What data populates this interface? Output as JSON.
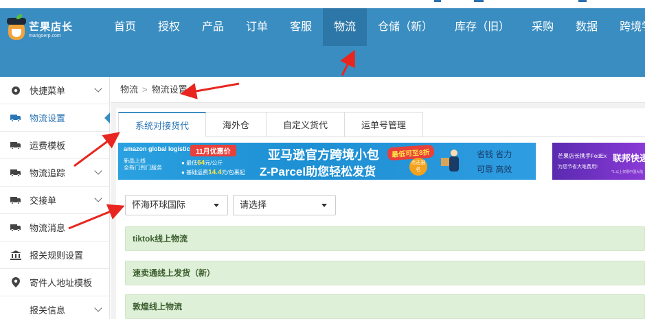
{
  "header": {
    "logo": {
      "name": "芒果店长",
      "domain": "mangoerp.com"
    },
    "nav": [
      {
        "label": "首页",
        "active": false
      },
      {
        "label": "授权",
        "active": false
      },
      {
        "label": "产品",
        "active": false
      },
      {
        "label": "订单",
        "active": false
      },
      {
        "label": "客服",
        "active": false
      },
      {
        "label": "物流",
        "active": true
      },
      {
        "label": "仓储（新）",
        "active": false
      },
      {
        "label": "库存（旧）",
        "active": false
      },
      {
        "label": "采购",
        "active": false
      },
      {
        "label": "数据",
        "active": false
      },
      {
        "label": "跨境学",
        "active": false
      }
    ]
  },
  "sidebar": {
    "items": [
      {
        "label": "快捷菜单",
        "icon": "dashboard-icon",
        "has_chevron": true,
        "active": false
      },
      {
        "label": "物流设置",
        "icon": "truck-icon",
        "has_chevron": false,
        "active": true
      },
      {
        "label": "运费模板",
        "icon": "truck-icon",
        "has_chevron": false,
        "active": false
      },
      {
        "label": "物流追踪",
        "icon": "truck-icon",
        "has_chevron": true,
        "active": false
      },
      {
        "label": "交接单",
        "icon": "truck-icon",
        "has_chevron": true,
        "active": false
      },
      {
        "label": "物流消息",
        "icon": "truck-icon",
        "has_chevron": false,
        "active": false
      },
      {
        "label": "报关规则设置",
        "icon": "bank-icon",
        "has_chevron": false,
        "active": false
      },
      {
        "label": "寄件人地址模板",
        "icon": "location-pin-icon",
        "has_chevron": false,
        "active": false
      },
      {
        "label": "报关信息",
        "icon": "",
        "has_chevron": true,
        "active": false
      }
    ]
  },
  "breadcrumb": {
    "root": "物流",
    "separator": ">",
    "current": "物流设置"
  },
  "tabs": [
    {
      "label": "系统对接货代",
      "active": true
    },
    {
      "label": "海外仓",
      "active": false
    },
    {
      "label": "自定义货代",
      "active": false
    },
    {
      "label": "运单号管理",
      "active": false
    }
  ],
  "banner": {
    "brand": "amazon global logistics",
    "left_line1": "新品上线",
    "left_line2": "全新门到门服务",
    "promo_tag": "11月优惠价",
    "price1_prefix": "最低",
    "price1_value": "64",
    "price1_unit": "元/公斤",
    "price2_prefix": "基础运费",
    "price2_value": "14.4",
    "price2_unit": "元/包裹起",
    "title_line1": "亚马逊官方跨境小包",
    "title_line2": "Z-Parcel助您轻松发货",
    "discount_badge": "最低可至8折",
    "cta": "点击报名",
    "features": [
      "省钱 省力",
      "可靠 高效"
    ]
  },
  "banner2": {
    "line1": "芒果店长携手FedEx",
    "line2": "为您节省大笔费用!",
    "big": "联邦快递",
    "tiny": "*1.以上仅限中国大陆"
  },
  "filters": {
    "carrier_select": {
      "value": "怀海环球国际"
    },
    "service_select": {
      "value": "请选择"
    }
  },
  "groups": [
    {
      "label": "tiktok线上物流"
    },
    {
      "label": "速卖通线上发货（新）"
    },
    {
      "label": "敦煌线上物流"
    }
  ],
  "colors": {
    "header": "#3a8dc1",
    "nav_active": "#2d77a8",
    "accent": "#2a76b5",
    "group_bg": "#dff0d8",
    "annotation_arrow": "#e8261f"
  }
}
